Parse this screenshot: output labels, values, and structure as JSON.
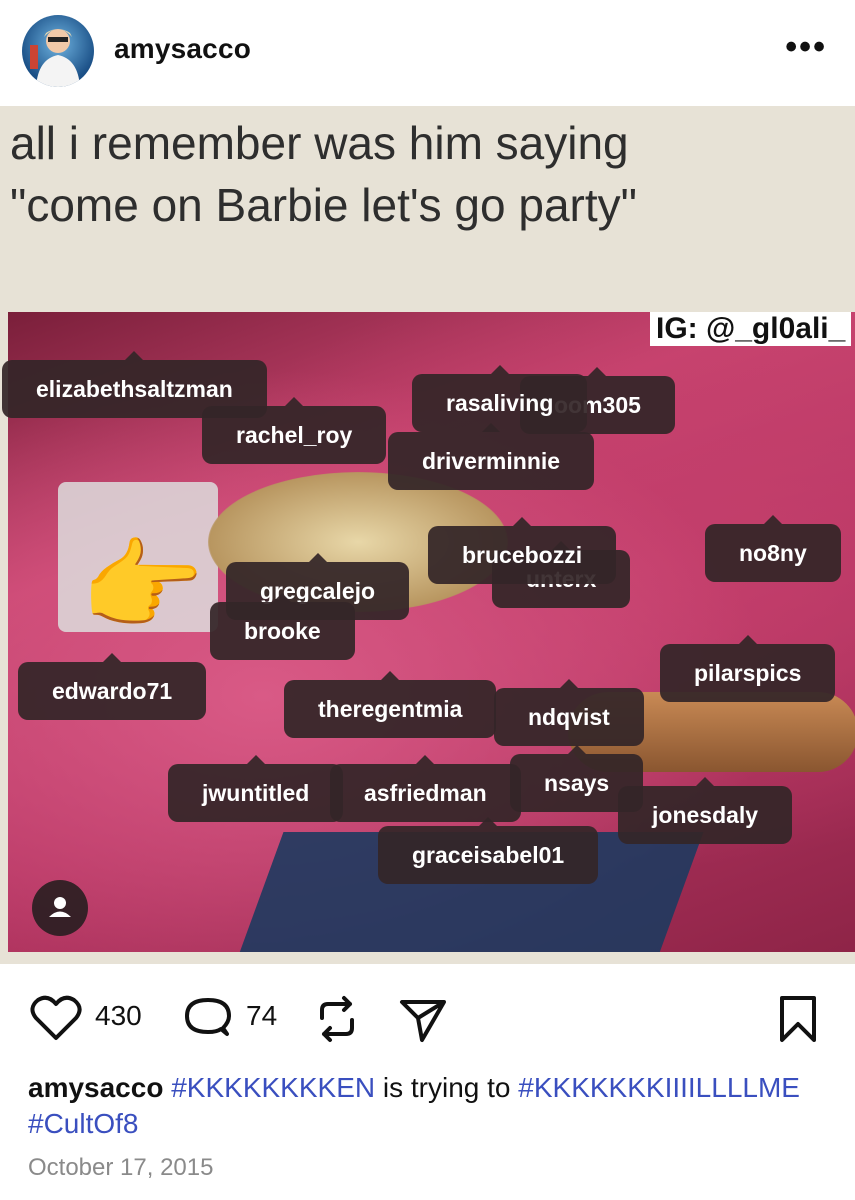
{
  "header": {
    "username": "amysacco",
    "more_label": "•••"
  },
  "post": {
    "image_caption_line1": "all i remember was him saying",
    "image_caption_line2": "\"come on Barbie let's go party\"",
    "watermark": "IG: @_gl0ali_",
    "tags": [
      "elizabethsaltzman",
      "rasaliving",
      "oom305",
      "rachel_roy",
      "driverminnie",
      "brucebozzi",
      "no8ny",
      "unterx",
      "gregcalejo",
      "brooke",
      "edwardo71",
      "pilarspics",
      "theregentmia",
      "ndqvist",
      "nsays",
      "jwuntitled",
      "asfriedman",
      "jonesdaly",
      "graceisabel01"
    ]
  },
  "actions": {
    "likes": "430",
    "comments": "74"
  },
  "caption": {
    "user": "amysacco",
    "hashtag1": "#KKKKKKKKEN",
    "text": " is trying to ",
    "hashtag2": "#KKKKKKKIIIILLLLME",
    "hashtag3": "#CultOf8"
  },
  "date": "October 17, 2015",
  "colors": {
    "hashtag": "#3a4fbf",
    "tag_bg": "#342628"
  }
}
